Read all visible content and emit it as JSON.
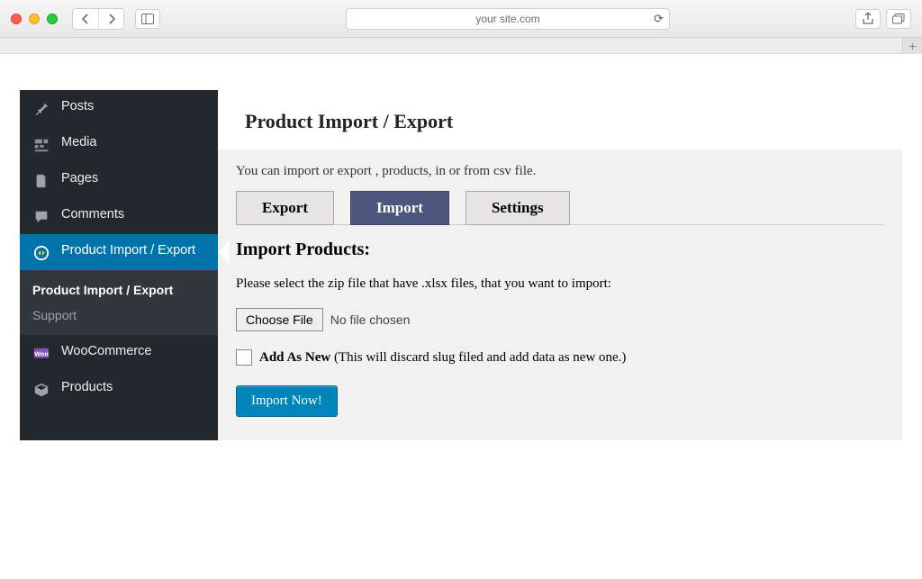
{
  "browser": {
    "url": "your site.com"
  },
  "sidebar": {
    "items": [
      {
        "icon": "pin",
        "label": "Posts"
      },
      {
        "icon": "media",
        "label": "Media"
      },
      {
        "icon": "pages",
        "label": "Pages"
      },
      {
        "icon": "comments",
        "label": "Comments"
      },
      {
        "icon": "import",
        "label": "Product Import / Export"
      },
      {
        "icon": "woo",
        "label": "WooCommerce"
      },
      {
        "icon": "products",
        "label": "Products"
      }
    ],
    "sub": [
      {
        "label": "Product Import / Export",
        "selected": true
      },
      {
        "label": "Support",
        "selected": false
      }
    ]
  },
  "page": {
    "title": "Product Import / Export",
    "description": "You can import or export , products, in or from csv file.",
    "tabs": [
      "Export",
      "Import",
      "Settings"
    ],
    "active_tab": "Import",
    "section_title": "Import Products:",
    "instruction": "Please select the zip file that have .xlsx files, that you want to import:",
    "file_button": "Choose File",
    "file_status": "No file chosen",
    "checkbox_label_strong": "Add As New",
    "checkbox_label_rest": " (This will discard slug filed and add data as new one.)",
    "submit": "Import Now!"
  }
}
